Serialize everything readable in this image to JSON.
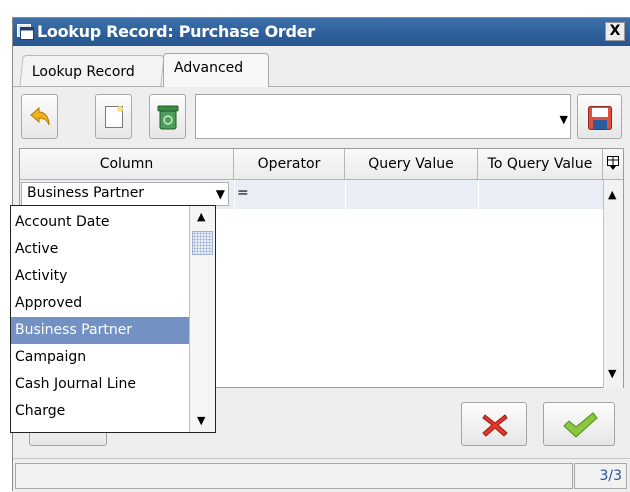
{
  "window": {
    "title": "Lookup Record: Purchase Order",
    "close_label": "X"
  },
  "tabs": [
    {
      "label": "Lookup Record"
    },
    {
      "label": "Advanced"
    }
  ],
  "toolbar": {
    "icons": [
      "undo-icon",
      "new-record-icon",
      "delete-icon",
      "save-icon"
    ],
    "query_combo_value": ""
  },
  "grid": {
    "headers": [
      "Column",
      "Operator",
      "Query Value",
      "To Query Value"
    ],
    "header_menu_icon": "column-chooser-icon",
    "row": {
      "column": "Business Partner",
      "operator": "=",
      "query_value": "",
      "to_query_value": ""
    }
  },
  "column_dropdown": {
    "options": [
      "Account Date",
      "Active",
      "Activity",
      "Approved",
      "Business Partner",
      "Campaign",
      "Cash Journal Line",
      "Charge"
    ],
    "selected": "Business Partner"
  },
  "buttons": {
    "cancel_icon": "cancel-icon",
    "ok_icon": "ok-check-icon"
  },
  "status": {
    "message": "",
    "record_count": "3/3"
  },
  "colors": {
    "titlebar": "#2d5e9a",
    "selection": "#7391c2",
    "row_highlight": "#e9eef5",
    "count_text": "#2a4f9c"
  }
}
